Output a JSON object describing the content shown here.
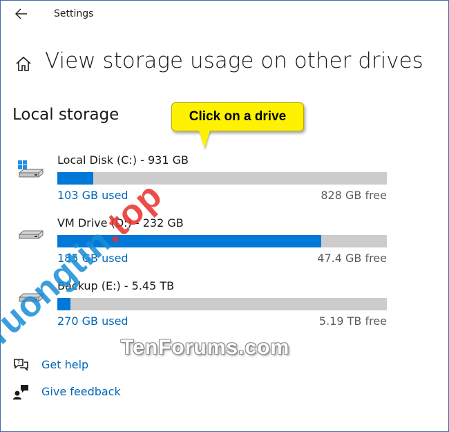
{
  "window": {
    "title": "Settings"
  },
  "page": {
    "title": "View storage usage on other drives",
    "section_title": "Local storage"
  },
  "callout": {
    "text": "Click on a drive"
  },
  "drives": [
    {
      "name": "Local Disk (C:) - 931 GB",
      "used": "103 GB used",
      "free": "828 GB free",
      "used_fraction": 0.11,
      "icon": "windows-system-drive-icon"
    },
    {
      "name": "VM Drive (D:) - 232 GB",
      "used": "185 GB used",
      "free": "47.4 GB free",
      "used_fraction": 0.8,
      "icon": "hard-drive-icon"
    },
    {
      "name": "Backup (E:) - 5.45 TB",
      "used": "270 GB used",
      "free": "5.19 TB free",
      "used_fraction": 0.04,
      "icon": "hard-drive-icon"
    }
  ],
  "links": {
    "help": "Get help",
    "feedback": "Give feedback"
  },
  "watermarks": {
    "tenforums": "TenForums.com",
    "site_part1": "Truongtin",
    "site_part2": ".top"
  },
  "colors": {
    "accent": "#0078d7",
    "link": "#0067b8",
    "bar_track": "#cccccc",
    "callout": "#fff200"
  }
}
